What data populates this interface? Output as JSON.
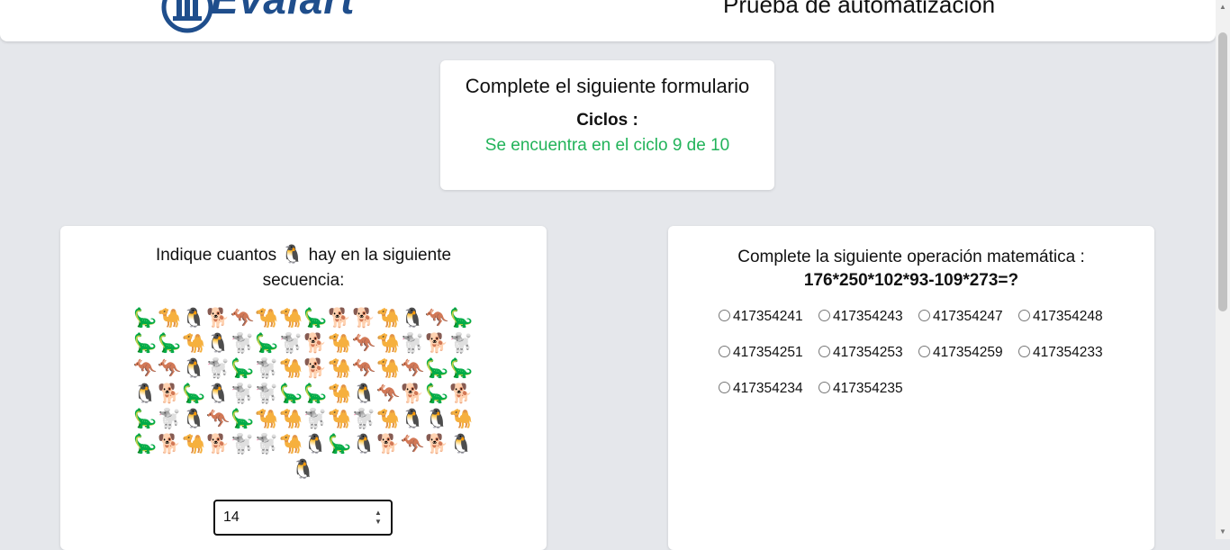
{
  "header": {
    "logo_text": "Evalart",
    "title": "Prueba de automatización"
  },
  "summary": {
    "title": "Complete el siguiente formulario",
    "cycles_label": "Ciclos :",
    "cycles_value": "Se encuentra en el ciclo 9 de 10"
  },
  "question_left": {
    "prefix": "Indique cuantos",
    "target_icon": "🐧",
    "suffix": "hay en la siguiente secuencia:",
    "sequence": [
      "🦕",
      "🐪",
      "🐧",
      "🐕",
      "🦘",
      "🐪",
      "🐪",
      "🦕",
      "🐕",
      "🐕",
      "🐪",
      "🐧",
      "🦘",
      "🦕",
      "🦕",
      "🦕",
      "🐪",
      "🐧",
      "🐩",
      "🦕",
      "🐩",
      "🐕",
      "🐪",
      "🦘",
      "🐪",
      "🐩",
      "🐕",
      "🐩",
      "🦘",
      "🦘",
      "🐧",
      "🐩",
      "🦕",
      "🐩",
      "🐪",
      "🐕",
      "🐪",
      "🦘",
      "🐪",
      "🦘",
      "🦕",
      "🦕",
      "🐧",
      "🐕",
      "🦕",
      "🐧",
      "🐩",
      "🐩",
      "🦕",
      "🦕",
      "🐪",
      "🐧",
      "🦘",
      "🐕",
      "🦕",
      "🐕",
      "🦕",
      "🐩",
      "🐧",
      "🦘",
      "🦕",
      "🐪",
      "🐪",
      "🐩",
      "🐪",
      "🐩",
      "🐪",
      "🐧",
      "🐧",
      "🐪",
      "🦕",
      "🐕",
      "🐪",
      "🐕",
      "🐩",
      "🐩",
      "🐪",
      "🐧",
      "🦕",
      "🐧",
      "🐕",
      "🦘",
      "🐕",
      "🐧",
      "🐧"
    ],
    "answer_value": "14"
  },
  "question_right": {
    "title": "Complete la siguiente operación matemática :",
    "expression": "176*250*102*93-109*273=?",
    "options": [
      "417354241",
      "417354243",
      "417354247",
      "417354248",
      "417354251",
      "417354253",
      "417354259",
      "417354233",
      "417354234",
      "417354235"
    ]
  }
}
